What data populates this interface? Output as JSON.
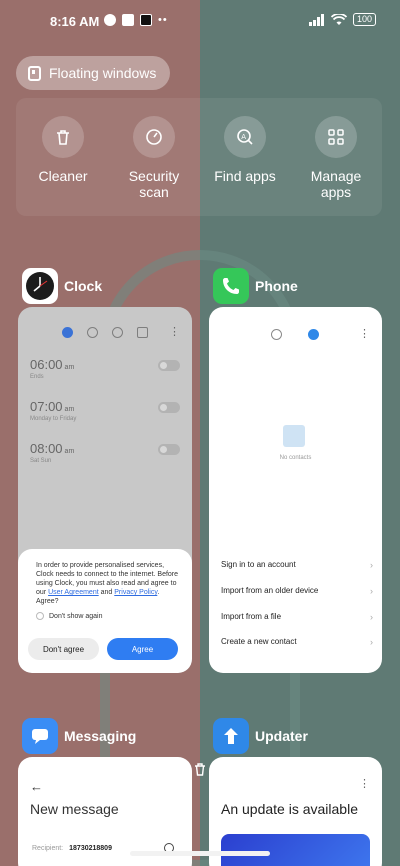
{
  "status_bar": {
    "time": "8:16 AM",
    "battery": "100"
  },
  "floating_windows": {
    "label": "Floating windows"
  },
  "quick_actions": [
    {
      "icon": "trash-icon",
      "label": "Cleaner"
    },
    {
      "icon": "shield-icon",
      "label": "Security\nscan"
    },
    {
      "icon": "search-app-icon",
      "label": "Find apps"
    },
    {
      "icon": "grid-icon",
      "label": "Manage\napps"
    }
  ],
  "apps": {
    "clock": {
      "name": "Clock",
      "alarms": [
        {
          "time": "06:00",
          "ampm": "am",
          "sub": "Ends"
        },
        {
          "time": "07:00",
          "ampm": "am",
          "sub": "Monday to Friday"
        },
        {
          "time": "08:00",
          "ampm": "am",
          "sub": "Sat Sun"
        }
      ],
      "dialog": {
        "text": "In order to provide personalised services, Clock needs to connect to the internet. Before using Clock, you must also read and agree to our",
        "link1": "User Agreement",
        "and": "and",
        "link2": "Privacy Policy",
        "agree_q": ". Agree?",
        "checkbox": "Don't show again",
        "dont_agree": "Don't agree",
        "agree": "Agree"
      }
    },
    "phone": {
      "name": "Phone",
      "empty": "No contacts",
      "rows": [
        "Sign in to an account",
        "Import from an older device",
        "Import from a file",
        "Create a new contact"
      ]
    },
    "messaging": {
      "name": "Messaging",
      "title": "New message",
      "recipient_label": "Recipient:",
      "recipient_value": "18730218809"
    },
    "updater": {
      "name": "Updater",
      "title": "An update is available"
    }
  },
  "colors": {
    "accent_blue": "#2f7df2",
    "phone_green": "#35c759",
    "messaging_blue": "#3a8df5",
    "updater_blue": "#2f88e8"
  }
}
